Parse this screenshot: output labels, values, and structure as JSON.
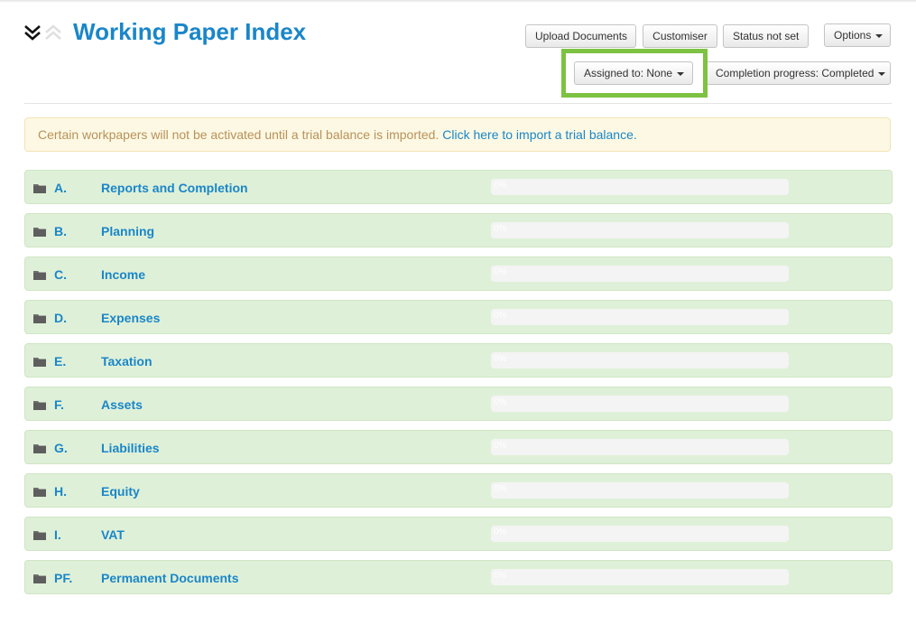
{
  "header": {
    "title": "Working Paper Index",
    "collapse_icon": "double-chevron-down-icon",
    "expand_icon": "double-chevron-up-icon"
  },
  "toolbar": {
    "upload_label": "Upload Documents",
    "customiser_label": "Customiser",
    "status_label": "Status not set",
    "options_label": "Options",
    "assigned_label": "Assigned to: None",
    "completion_label": "Completion progress: Completed"
  },
  "alert": {
    "text": "Certain workpapers will not be activated until a trial balance is imported.",
    "link": "Click here to import a trial balance."
  },
  "colors": {
    "accent": "#1a86c8",
    "row_bg": "#dff0d8",
    "alert_bg": "#fcf8e3",
    "highlight": "#7dc242"
  },
  "sections": [
    {
      "code": "A.",
      "name": "Reports and Completion",
      "progress": 0,
      "progress_label": "0%"
    },
    {
      "code": "B.",
      "name": "Planning",
      "progress": 0,
      "progress_label": "0%"
    },
    {
      "code": "C.",
      "name": "Income",
      "progress": 0,
      "progress_label": "0%"
    },
    {
      "code": "D.",
      "name": "Expenses",
      "progress": 0,
      "progress_label": "0%"
    },
    {
      "code": "E.",
      "name": "Taxation",
      "progress": 0,
      "progress_label": "0%"
    },
    {
      "code": "F.",
      "name": "Assets",
      "progress": 0,
      "progress_label": "0%"
    },
    {
      "code": "G.",
      "name": "Liabilities",
      "progress": 0,
      "progress_label": "0%"
    },
    {
      "code": "H.",
      "name": "Equity",
      "progress": 0,
      "progress_label": "0%"
    },
    {
      "code": "I.",
      "name": "VAT",
      "progress": 0,
      "progress_label": "0%"
    },
    {
      "code": "PF.",
      "name": "Permanent Documents",
      "progress": 0,
      "progress_label": "0%"
    }
  ]
}
